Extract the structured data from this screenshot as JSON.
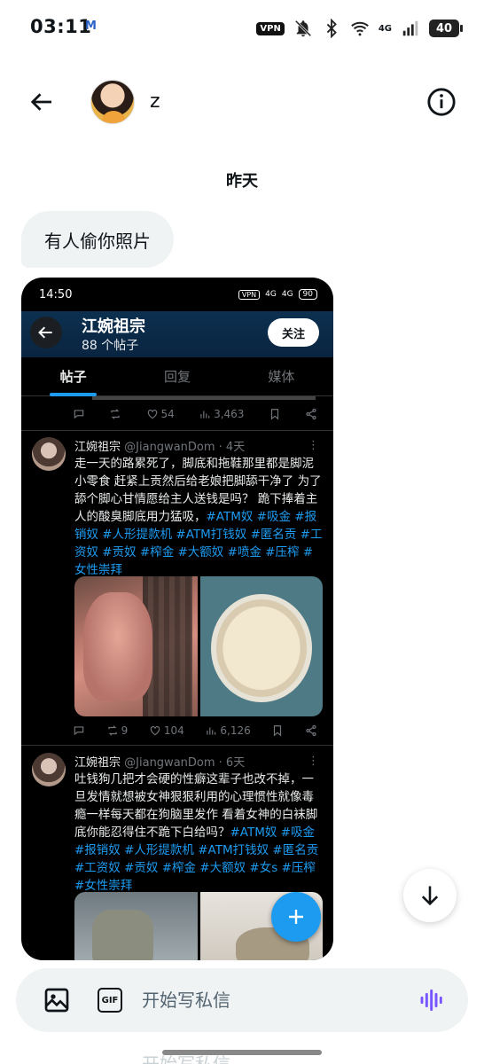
{
  "status_bar": {
    "time": "03:11",
    "mail_icon": "M",
    "vpn": "VPN",
    "network": "4G",
    "battery": "40"
  },
  "header": {
    "contact_name": "z"
  },
  "conversation": {
    "date_separator": "昨天",
    "messages": [
      {
        "text": "有人偷你照片",
        "from": "contact"
      }
    ]
  },
  "attachment": {
    "status_time": "14:50",
    "status_vpn": "VPN",
    "status_net1": "4G",
    "status_net2": "4G",
    "status_battery": "90",
    "profile_name": "江婉祖宗",
    "post_count": "88 个帖子",
    "follow_label": "关注",
    "tabs": [
      "帖子",
      "回复",
      "媒体"
    ],
    "prev_actions": {
      "likes": "54",
      "views": "3,463"
    },
    "tweets": [
      {
        "name": "江婉祖宗",
        "handle": "@JiangwanDom",
        "time": "· 4天",
        "text": "走一天的路累死了，脚底和拖鞋那里都是脚泥小零食 赶紧上贡然后给老娘把脚舔干净了 为了舔个脚心甘情愿给主人送钱是吗？ 跪下捧着主人的酸臭脚底用力猛吸，",
        "tags": "#ATM奴 #吸金 #报销奴 #人形提款机 #ATM打钱奴 #匿名贡 #工资奴 #贡奴 #榨金 #大额奴 #喷金 #压榨 #女性崇拜",
        "retweets": "9",
        "likes": "104",
        "views": "6,126"
      },
      {
        "name": "江婉祖宗",
        "handle": "@JiangwanDom",
        "time": "· 6天",
        "text": "吐钱狗几把才会硬的性癖这辈子也改不掉，一旦发情就想被女神狠狠利用的心理惯性就像毒瘾一样每天都在狗脑里发作 看着女神的白袜脚底你能忍得住不跪下白给吗？",
        "tags": "#ATM奴 #吸金 #报销奴 #人形提款机 #ATM打钱奴 #匿名贡 #工资奴 #贡奴 #榨金 #大额奴 #女s #压榨 #女性崇拜"
      }
    ]
  },
  "composer": {
    "placeholder": "开始写私信",
    "gif_label": "GIF"
  },
  "ghost_row": {
    "text": "开始写私信"
  },
  "colors": {
    "accent": "#1d9bf0",
    "voice": "#7856ff",
    "bubble": "#eff3f4"
  },
  "icons": [
    "back-arrow-icon",
    "info-icon",
    "image-icon",
    "gif-icon",
    "voice-icon",
    "arrow-down-icon",
    "plus-icon"
  ]
}
